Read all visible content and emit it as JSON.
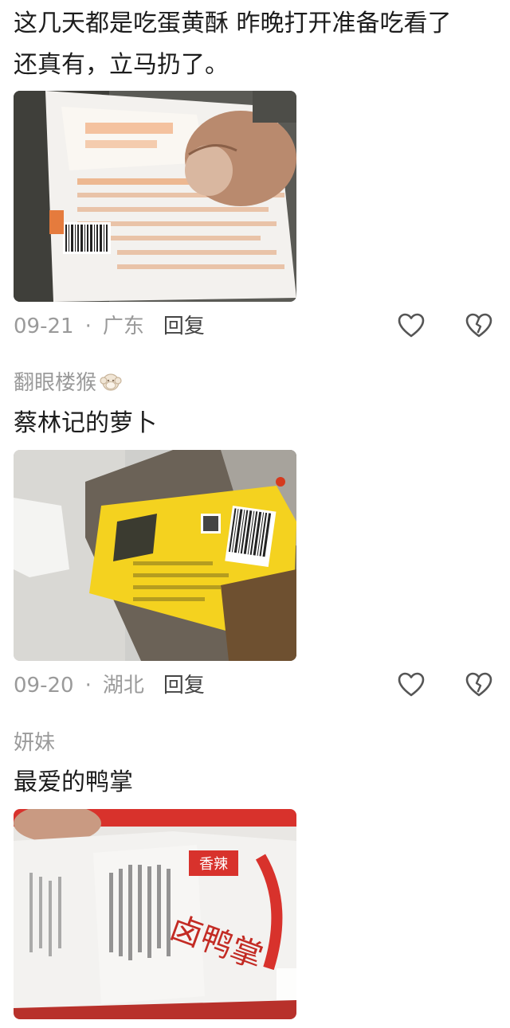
{
  "comments": [
    {
      "username": "",
      "text_lines": [
        "这几天都是吃蛋黄酥  昨晚打开准备吃看了",
        "还真有，立马扔了。"
      ],
      "date": "09-21",
      "region": "广东",
      "reply_label": "回复"
    },
    {
      "username": "翻眼楼猴",
      "username_emoji": "monkey-emoji-icon",
      "text_lines": [
        "蔡林记的萝卜"
      ],
      "date": "09-20",
      "region": "湖北",
      "reply_label": "回复"
    },
    {
      "username": "妍妹",
      "text_lines": [
        "最爱的鸭掌"
      ]
    }
  ],
  "photo_text": {
    "photo3_stamp": "香辣",
    "photo3_product": "卤鸭掌"
  },
  "colors": {
    "meta_gray": "#9a9a9a",
    "text_dark": "#1c1c1c",
    "yellow_pack": "#f4d21f",
    "red_print": "#d8322c"
  }
}
